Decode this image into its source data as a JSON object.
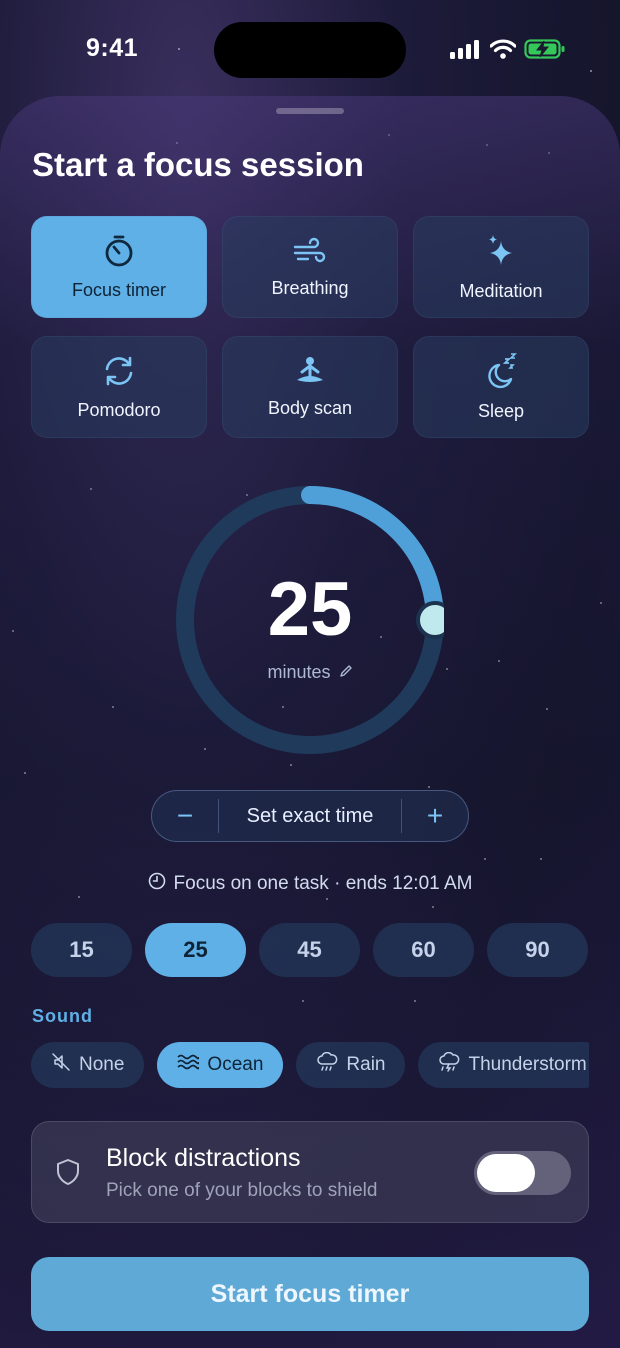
{
  "status_bar": {
    "time": "9:41"
  },
  "sheet": {
    "title": "Start a focus session",
    "modes": [
      {
        "label": "Focus timer",
        "icon": "timer-icon",
        "active": true
      },
      {
        "label": "Breathing",
        "icon": "wind-icon",
        "active": false
      },
      {
        "label": "Meditation",
        "icon": "sparkles-icon",
        "active": false
      },
      {
        "label": "Pomodoro",
        "icon": "cycle-icon",
        "active": false
      },
      {
        "label": "Body scan",
        "icon": "meditating-figure-icon",
        "active": false
      },
      {
        "label": "Sleep",
        "icon": "moon-zzz-icon",
        "active": false
      }
    ]
  },
  "timer": {
    "value": "25",
    "unit": "minutes",
    "progress_fraction": 0.25,
    "stepper": {
      "minus": "−",
      "label": "Set exact time",
      "plus": "+"
    },
    "info": "Focus on one task · ends 12:01 AM"
  },
  "presets": [
    {
      "label": "15",
      "active": false
    },
    {
      "label": "25",
      "active": true
    },
    {
      "label": "45",
      "active": false
    },
    {
      "label": "60",
      "active": false
    },
    {
      "label": "90",
      "active": false
    }
  ],
  "sound": {
    "heading": "Sound",
    "options": [
      {
        "label": "None",
        "icon": "speaker-muted-icon",
        "active": false
      },
      {
        "label": "Ocean",
        "icon": "waves-icon",
        "active": true
      },
      {
        "label": "Rain",
        "icon": "rain-cloud-icon",
        "active": false
      },
      {
        "label": "Thunderstorm",
        "icon": "storm-cloud-icon",
        "active": false
      }
    ]
  },
  "block": {
    "title": "Block distractions",
    "subtitle": "Pick one of your blocks to shield",
    "enabled": false
  },
  "start_button": {
    "label": "Start focus timer"
  },
  "colors": {
    "accent": "#5fb0e6",
    "progress_thumb": "#bfe9ec",
    "ring_track": "#1f3a5a",
    "battery": "#34c759"
  }
}
